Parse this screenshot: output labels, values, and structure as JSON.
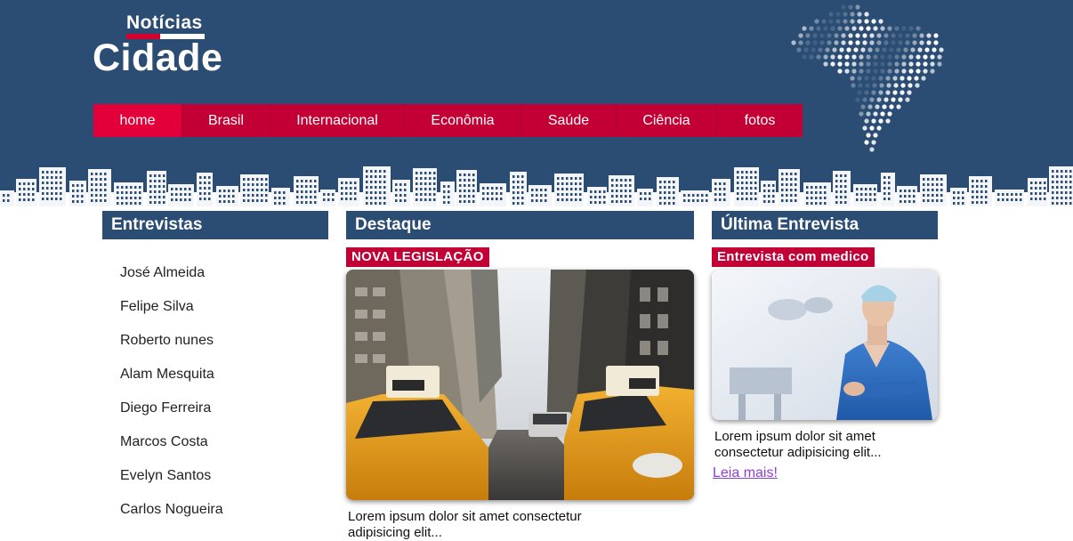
{
  "header": {
    "logo_top": "Notícias",
    "logo_main": "Cidade",
    "background_color": "#2b4d74",
    "accent_color": "#c20035"
  },
  "nav": {
    "items": [
      {
        "label": "home",
        "active": true
      },
      {
        "label": "Brasil"
      },
      {
        "label": "Internacional"
      },
      {
        "label": "Econômia"
      },
      {
        "label": "Saúde"
      },
      {
        "label": "Ciência"
      },
      {
        "label": "fotos"
      }
    ]
  },
  "entrevistas": {
    "title": "Entrevistas",
    "names": [
      "José Almeida",
      "Felipe Silva",
      "Roberto nunes",
      "Alam Mesquita",
      "Diego Ferreira",
      "Marcos Costa",
      "Evelyn Santos",
      "Carlos Nogueira"
    ]
  },
  "destaque": {
    "title": "Destaque",
    "tag": "NOVA LEGISLAÇÃO",
    "image_icon": "city-taxi-photo",
    "text": "Lorem ipsum dolor sit amet consectetur adipisicing elit..."
  },
  "ultima": {
    "title": "Última Entrevista",
    "tag": "Entrevista com medico",
    "image_icon": "doctor-photo",
    "text": "Lorem ipsum dolor sit amet consectetur adipisicing elit...",
    "link": "Leia mais!"
  }
}
